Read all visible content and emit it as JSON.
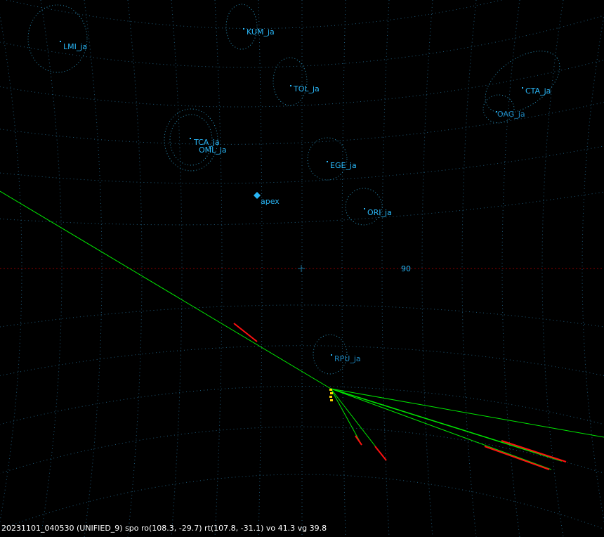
{
  "colors": {
    "background": "#000000",
    "grid": "#1f5a7a",
    "radiant_ring": "#2a90b8",
    "radiant_label": "#29b6f6",
    "radiant_label_dim": "#1e88c0",
    "apex": "#29b6f6",
    "horizon": "#8a0000",
    "meteor_track": "#00e600",
    "meteor_head": "#ff1010",
    "station_marker": "#ffd400",
    "status_text": "#ffffff",
    "azimuth_label": "#29b6f6"
  },
  "radiants": [
    {
      "name": "LMI_ja",
      "dim": false
    },
    {
      "name": "KUM_ja",
      "dim": false
    },
    {
      "name": "TOL_ja",
      "dim": false
    },
    {
      "name": "CTA_ja",
      "dim": false
    },
    {
      "name": "OAG_ja",
      "dim": true
    },
    {
      "name": "TCA_ja",
      "dim": false
    },
    {
      "name": "OML_ja",
      "dim": false
    },
    {
      "name": "EGE_ja",
      "dim": false
    },
    {
      "name": "ORI_ja",
      "dim": false
    },
    {
      "name": "RPU_ja",
      "dim": true
    }
  ],
  "apex": {
    "label": "apex"
  },
  "azimuth_label": "90",
  "center_marker_icon": "crosshair-icon",
  "status": "20231101_040530 (UNIFIED_9) spo ro(108.3, -29.7) rt(107.8, -31.1) vo 41.3 vg 39.8"
}
